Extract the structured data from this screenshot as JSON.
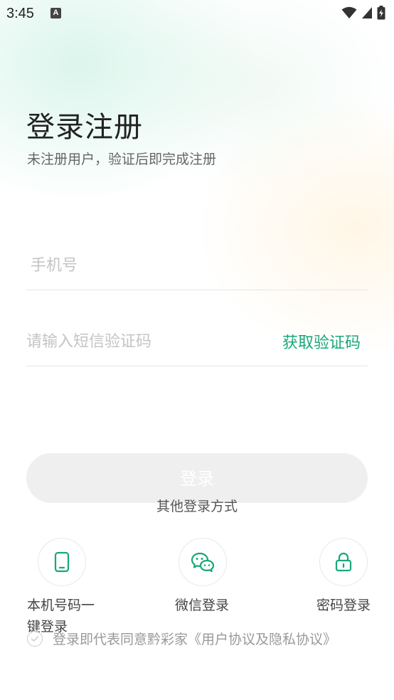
{
  "status_bar": {
    "time": "3:45",
    "notification_icon_letter": "A",
    "icons": [
      "a-notification-icon",
      "wifi-icon",
      "cell-signal-icon",
      "battery-charging-icon"
    ]
  },
  "header": {
    "title": "登录注册",
    "subtitle": "未注册用户，验证后即完成注册"
  },
  "form": {
    "phone": {
      "value": "",
      "placeholder": "手机号"
    },
    "code": {
      "value": "",
      "placeholder": "请输入短信验证码",
      "get_code_label": "获取验证码"
    },
    "login_label": "登录"
  },
  "other_login": {
    "title": "其他登录方式",
    "methods": [
      {
        "label": "本机号码一键登录",
        "icon": "phone-icon"
      },
      {
        "label": "微信登录",
        "icon": "wechat-icon"
      },
      {
        "label": "密码登录",
        "icon": "lock-icon"
      }
    ]
  },
  "agreement": {
    "prefix": "登录即代表同意黔彩家",
    "link": "《用户协议及隐私协议》",
    "checked": false
  },
  "colors": {
    "accent": "#18a87a",
    "button_disabled": "#efefef",
    "placeholder": "#c4c4c4",
    "divider": "#e6e6e6"
  }
}
